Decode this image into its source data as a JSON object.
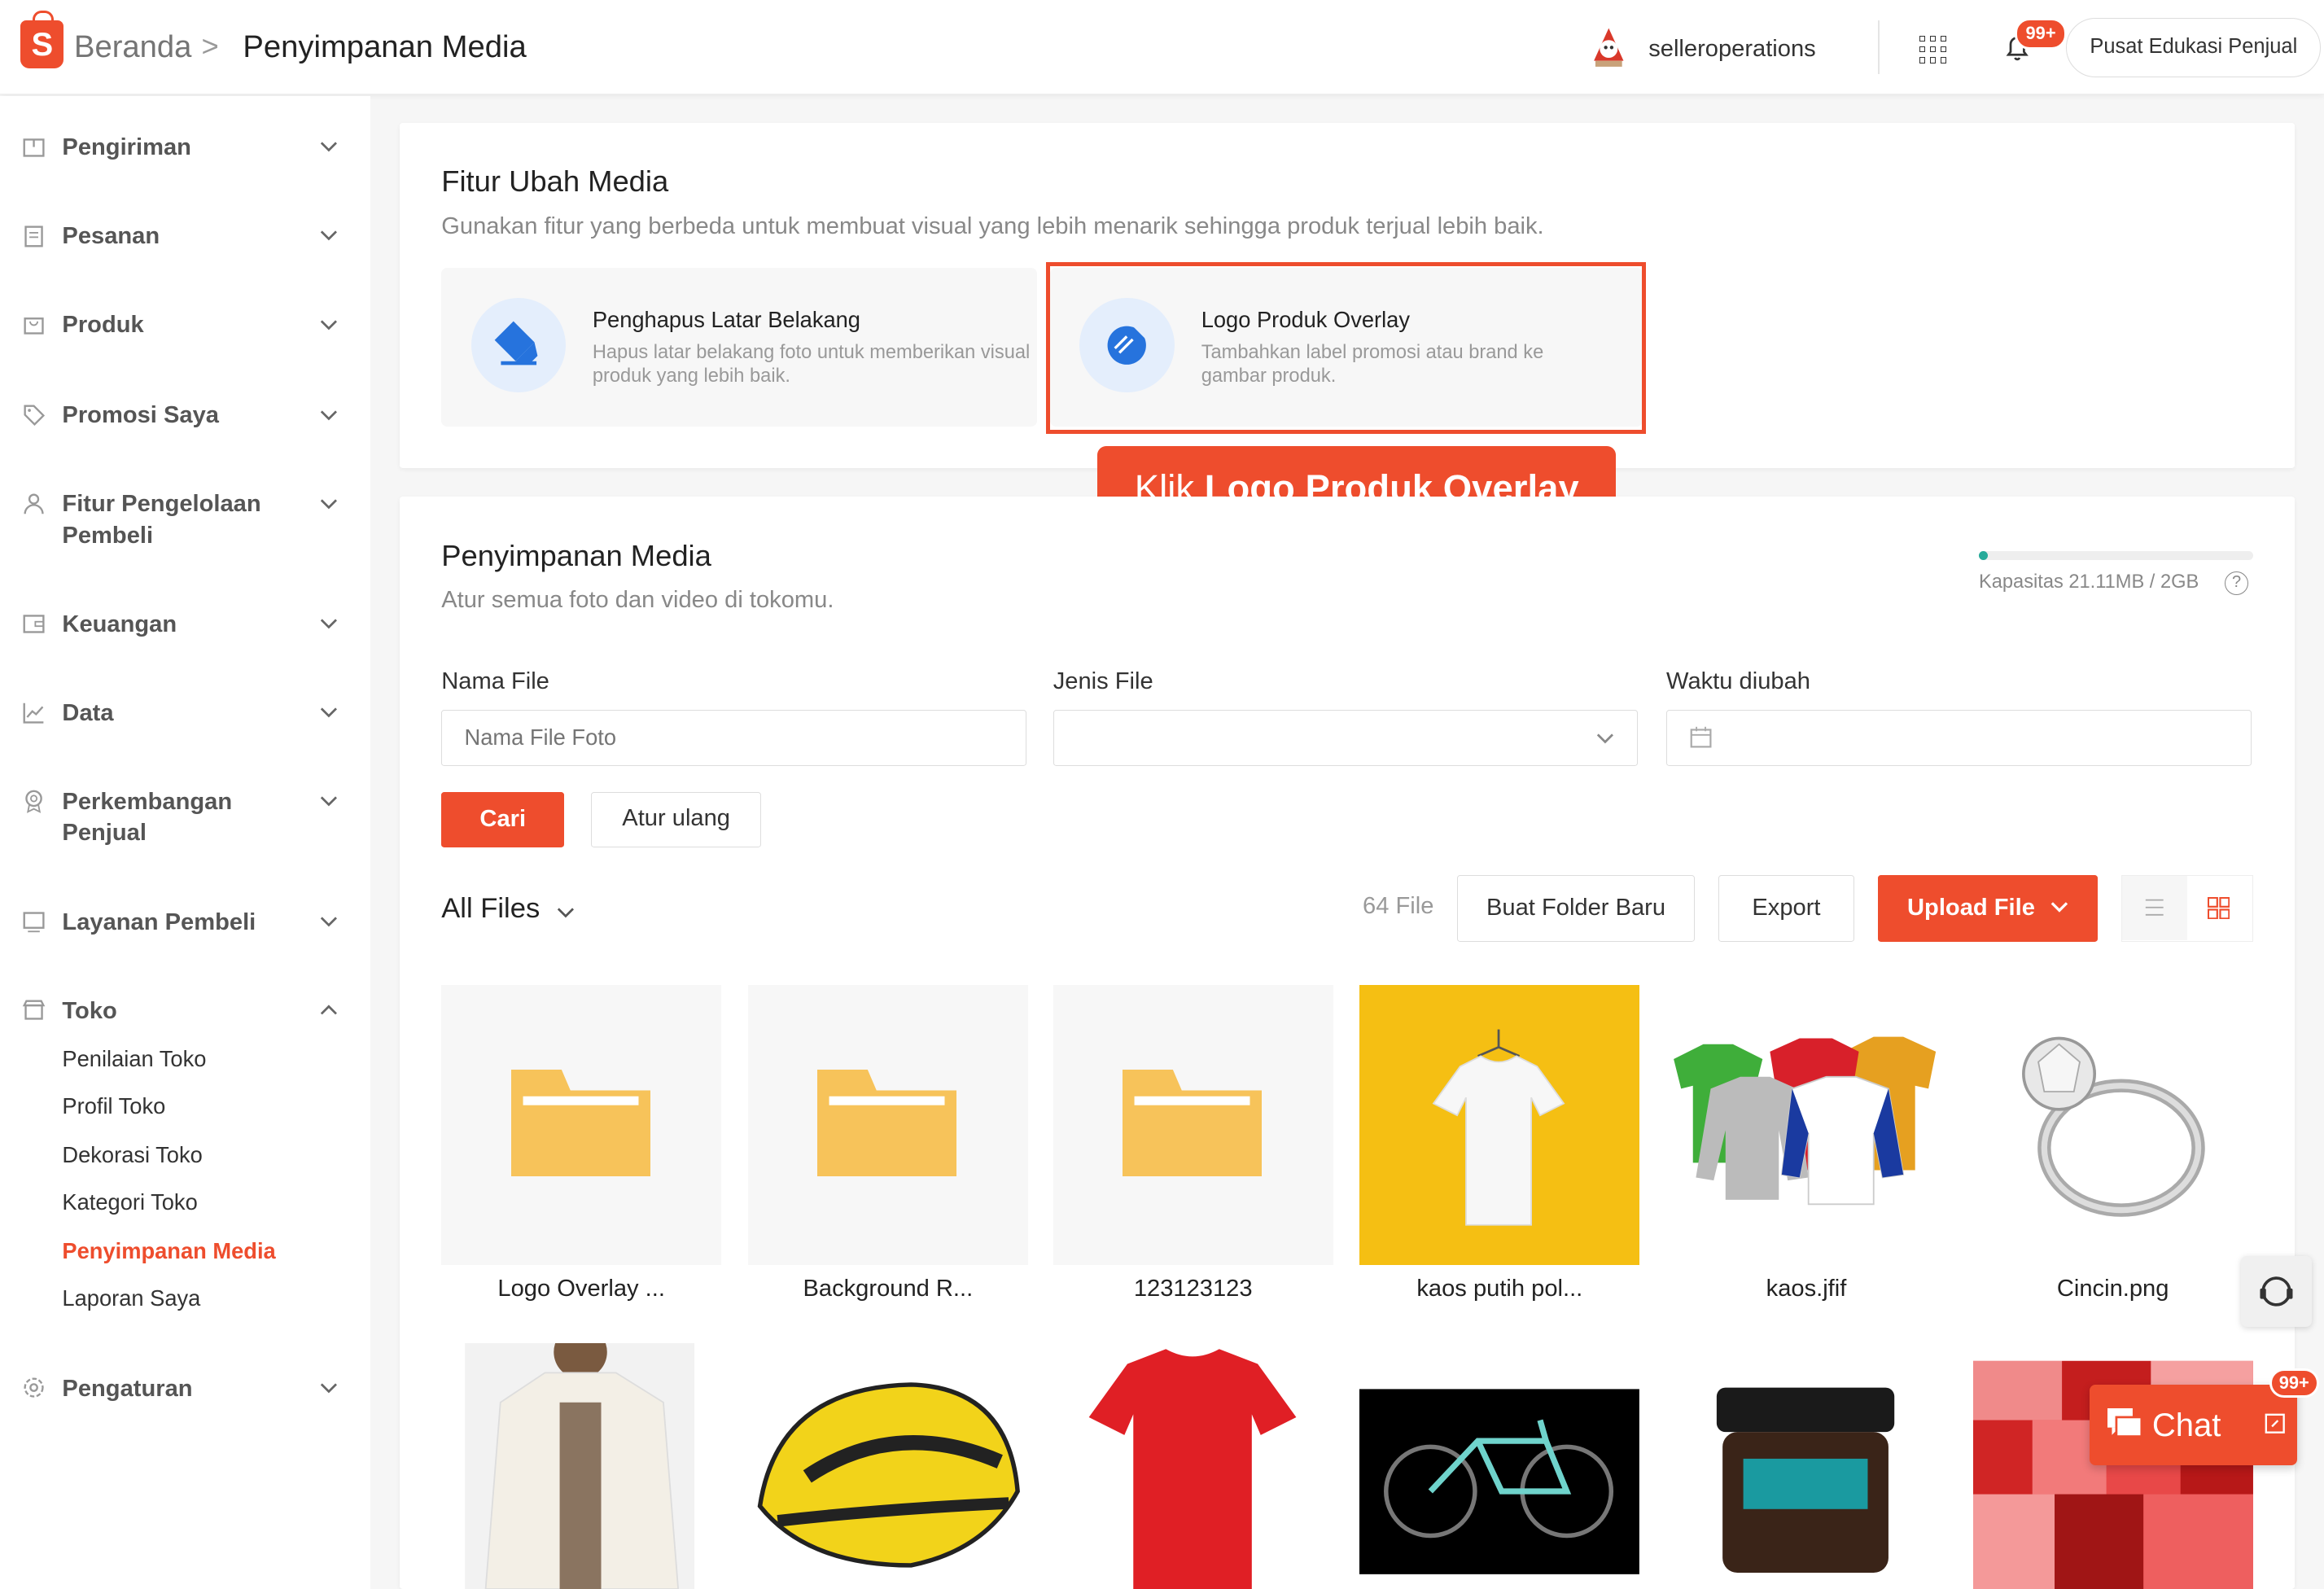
{
  "header": {
    "logo_letter": "S",
    "breadcrumb_home": "Beranda",
    "breadcrumb_sep": ">",
    "breadcrumb_current": "Penyimpanan Media",
    "username": "selleroperations",
    "notif_badge": "99+",
    "edu_button": "Pusat Edukasi Penjual"
  },
  "sidebar": {
    "items": [
      {
        "label": "Pengiriman",
        "icon": "box-icon"
      },
      {
        "label": "Pesanan",
        "icon": "clipboard-icon"
      },
      {
        "label": "Produk",
        "icon": "bag-icon"
      },
      {
        "label": "Promosi Saya",
        "icon": "tag-icon"
      },
      {
        "label": "Fitur Pengelolaan Pembeli",
        "icon": "users-icon"
      },
      {
        "label": "Keuangan",
        "icon": "wallet-icon"
      },
      {
        "label": "Data",
        "icon": "chart-icon"
      },
      {
        "label": "Perkembangan Penjual",
        "icon": "badge-icon"
      },
      {
        "label": "Layanan Pembeli",
        "icon": "chat-icon"
      },
      {
        "label": "Toko",
        "icon": "store-icon"
      },
      {
        "label": "Pengaturan",
        "icon": "gear-icon"
      }
    ],
    "toko_sub": [
      "Penilaian Toko",
      "Profil Toko",
      "Dekorasi Toko",
      "Kategori Toko",
      "Penyimpanan Media",
      "Laporan Saya"
    ],
    "active_sub": "Penyimpanan Media"
  },
  "features": {
    "title": "Fitur Ubah Media",
    "subtitle": "Gunakan fitur yang berbeda untuk membuat visual yang lebih menarik sehingga produk terjual lebih baik.",
    "cards": [
      {
        "title": "Penghapus Latar Belakang",
        "desc": "Hapus latar belakang foto untuk memberikan visual produk yang lebih baik."
      },
      {
        "title": "Logo Produk Overlay",
        "desc": "Tambahkan label promosi atau brand ke gambar produk."
      }
    ],
    "callout_prefix": "Klik ",
    "callout_bold": "Logo Produk Overlay"
  },
  "media": {
    "title": "Penyimpanan Media",
    "subtitle": "Atur semua foto dan video di tokomu.",
    "capacity_text": "Kapasitas 21.11MB / 2GB",
    "capacity_fraction": 0.0103,
    "filter": {
      "name_label": "Nama File",
      "name_placeholder": "Nama File Foto",
      "type_label": "Jenis File",
      "type_value": "",
      "time_label": "Waktu diubah",
      "search_btn": "Cari",
      "reset_btn": "Atur ulang"
    },
    "all_files": "All Files",
    "file_count": "64 File",
    "new_folder_btn": "Buat Folder Baru",
    "export_btn": "Export",
    "upload_btn": "Upload File",
    "tiles_row1": [
      "Logo Overlay ...",
      "Background R...",
      "123123123",
      "kaos putih pol...",
      "kaos.jfif",
      "Cincin.png"
    ]
  },
  "chat": {
    "label": "Chat",
    "badge": "99+"
  },
  "colors": {
    "brand": "#ee4d2d",
    "feature_icon": "#2673dd"
  }
}
